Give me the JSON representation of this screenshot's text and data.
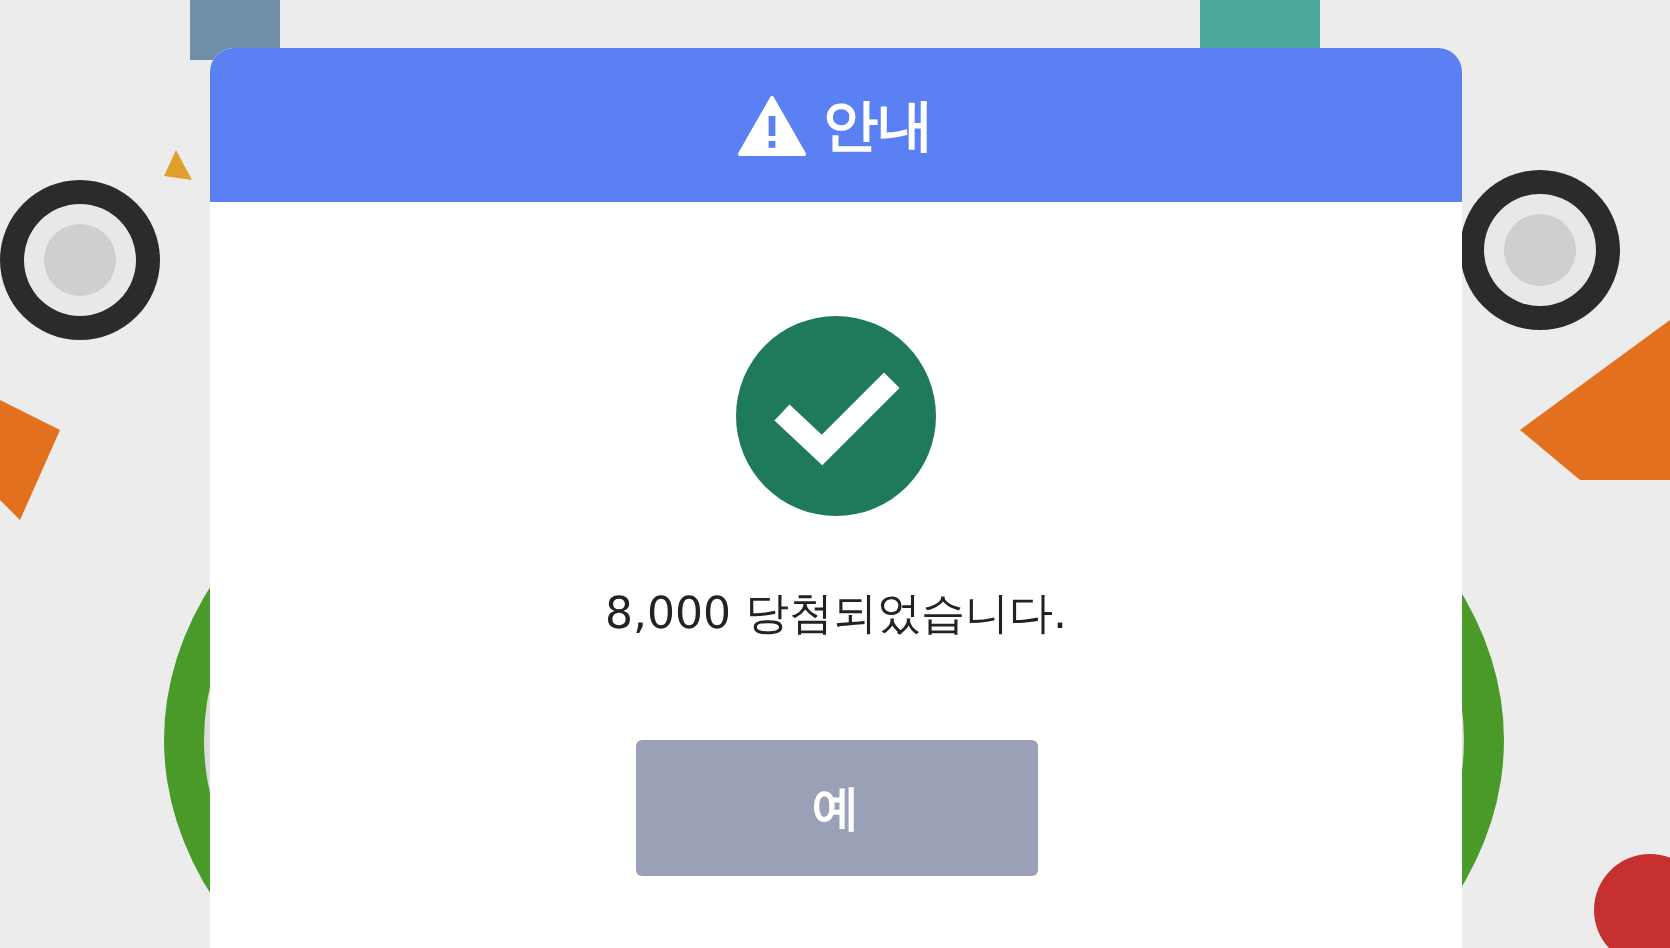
{
  "dialog": {
    "title": "안내",
    "message": "8,000 당첨되었습니다.",
    "buttons": [
      "예"
    ]
  }
}
